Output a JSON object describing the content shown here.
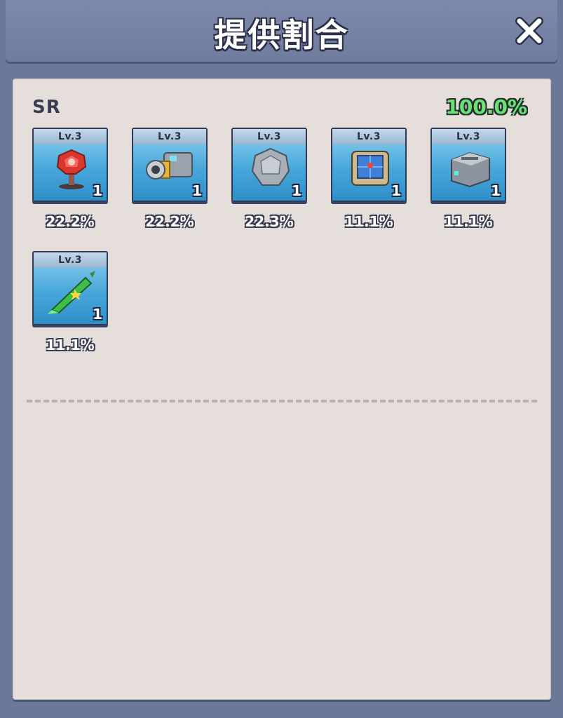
{
  "header": {
    "title": "提供割合",
    "close_label": "✕"
  },
  "section": {
    "rarity": "SR",
    "total_rate": "100.0%",
    "items": [
      {
        "level": "Lv.3",
        "count": "1",
        "rate": "22.2%",
        "icon": "radar-dish-icon"
      },
      {
        "level": "Lv.3",
        "count": "1",
        "rate": "22.2%",
        "icon": "cannon-barrel-icon"
      },
      {
        "level": "Lv.3",
        "count": "1",
        "rate": "22.3%",
        "icon": "armor-plate-icon"
      },
      {
        "level": "Lv.3",
        "count": "1",
        "rate": "11.1%",
        "icon": "scanner-screen-icon"
      },
      {
        "level": "Lv.3",
        "count": "1",
        "rate": "11.1%",
        "icon": "metal-crate-icon"
      },
      {
        "level": "Lv.3",
        "count": "1",
        "rate": "11.1%",
        "icon": "missile-icon"
      }
    ]
  },
  "colors": {
    "total_rate": "#6ee07a",
    "card_top": "#8fd3f0",
    "card_bottom": "#2f8fc9"
  }
}
